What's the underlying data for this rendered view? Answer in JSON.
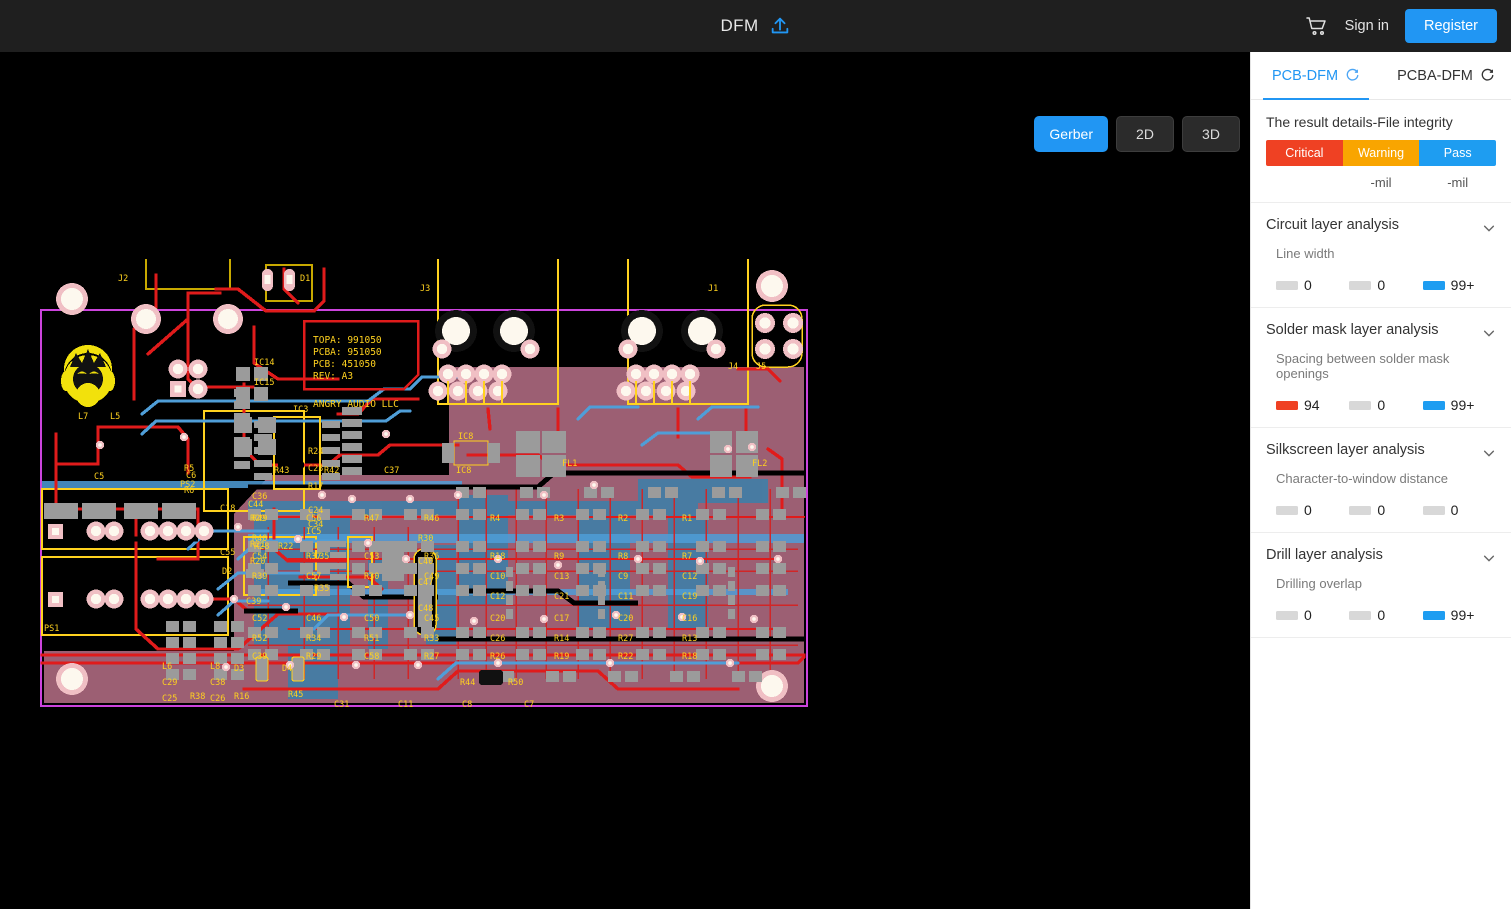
{
  "topbar": {
    "title": "DFM",
    "upload_icon": "upload-icon",
    "cart_icon": "cart-icon",
    "signin_label": "Sign in",
    "register_label": "Register"
  },
  "viewer": {
    "view_modes": [
      {
        "label": "Gerber",
        "active": true
      },
      {
        "label": "2D",
        "active": false
      },
      {
        "label": "3D",
        "active": false
      }
    ],
    "background": "#000000",
    "board": {
      "outline_color": "#cc44dd",
      "copper_pour_color": "#9c5f73",
      "silkscreen_color": "#ffd21f",
      "trace_red": "#e01b1b",
      "trace_blue": "#4f9ed8",
      "pad_color": "#f3c9cc",
      "drill_color": "#fdf6e3",
      "smd_pad_color": "#9b9b9b",
      "text_block": [
        "TOPA: 991050",
        "PCBA: 951050",
        "PCB: 451050",
        "REV: A3"
      ],
      "vendor": "ANGRY AUDIO LLC",
      "connector_labels": [
        "J1",
        "J2",
        "J3",
        "J4",
        "J5",
        "D1",
        "PS1",
        "PS2"
      ],
      "ic_labels": [
        "IC3",
        "IC5",
        "IC8",
        "IC14",
        "IC15"
      ],
      "filter_labels": [
        "FL1",
        "FL2"
      ],
      "diode_labels": [
        "D2",
        "D3",
        "D4"
      ],
      "inductor_labels": [
        "L5",
        "L6",
        "L7",
        "L8"
      ],
      "cap_labels": [
        "C5",
        "C6",
        "C7",
        "C8",
        "C9",
        "C10",
        "C11",
        "C12",
        "C13",
        "C16",
        "C17",
        "C18",
        "C19",
        "C20",
        "C21",
        "C23",
        "C24",
        "C25",
        "C26",
        "C31",
        "C32",
        "C34",
        "C35",
        "C36",
        "C37",
        "C38",
        "C39",
        "C40",
        "C43",
        "C44",
        "C45",
        "C46",
        "C47",
        "C48",
        "C49",
        "C50",
        "C52",
        "C53",
        "C54",
        "C55",
        "C56",
        "C57",
        "C58"
      ],
      "res_labels": [
        "R1",
        "R2",
        "R3",
        "R4",
        "R5",
        "R6",
        "R7",
        "R8",
        "R9",
        "R13",
        "R14",
        "R16",
        "R17",
        "R18",
        "R19",
        "R20",
        "R21",
        "R22",
        "R23",
        "R24",
        "R26",
        "R27",
        "R28",
        "R29",
        "R30",
        "R31",
        "R32",
        "R33",
        "R36",
        "R37",
        "R38",
        "R42",
        "R43",
        "R44",
        "R45",
        "R46",
        "R47",
        "R49",
        "R50",
        "R51",
        "R52"
      ]
    }
  },
  "panel": {
    "tabs": [
      {
        "label": "PCB-DFM",
        "active": true,
        "icon": "refresh-icon"
      },
      {
        "label": "PCBA-DFM",
        "active": false,
        "icon": "refresh-icon"
      }
    ],
    "heading": "The result details-File integrity",
    "legend": [
      {
        "label": "Critical",
        "color": "#ef4123"
      },
      {
        "label": "Warning",
        "color": "#f9a500"
      },
      {
        "label": "Pass",
        "color": "#1e9df1"
      }
    ],
    "mil_row": [
      "",
      "-mil",
      "-mil"
    ],
    "colors": {
      "critical": "#ef4123",
      "warning": "#f9a500",
      "pass": "#1e9df1",
      "neutral": "#d8d8d8",
      "accent": "#2196f3"
    },
    "sections": [
      {
        "title": "Circuit layer analysis",
        "subtitle": "Line width",
        "chevron": "chevron-down-icon",
        "counts": [
          {
            "value": "0",
            "color": "#d8d8d8",
            "level": "critical"
          },
          {
            "value": "0",
            "color": "#d8d8d8",
            "level": "warning"
          },
          {
            "value": "99+",
            "color": "#1e9df1",
            "level": "pass"
          }
        ]
      },
      {
        "title": "Solder mask layer analysis",
        "subtitle": "Spacing between solder mask openings",
        "chevron": "chevron-down-icon",
        "counts": [
          {
            "value": "94",
            "color": "#ef4123",
            "level": "critical"
          },
          {
            "value": "0",
            "color": "#d8d8d8",
            "level": "warning"
          },
          {
            "value": "99+",
            "color": "#1e9df1",
            "level": "pass"
          }
        ]
      },
      {
        "title": "Silkscreen layer analysis",
        "subtitle": "Character-to-window distance",
        "chevron": "chevron-down-icon",
        "counts": [
          {
            "value": "0",
            "color": "#d8d8d8",
            "level": "critical"
          },
          {
            "value": "0",
            "color": "#d8d8d8",
            "level": "warning"
          },
          {
            "value": "0",
            "color": "#d8d8d8",
            "level": "pass"
          }
        ]
      },
      {
        "title": "Drill layer analysis",
        "subtitle": "Drilling overlap",
        "chevron": "chevron-down-icon",
        "counts": [
          {
            "value": "0",
            "color": "#d8d8d8",
            "level": "critical"
          },
          {
            "value": "0",
            "color": "#d8d8d8",
            "level": "warning"
          },
          {
            "value": "99+",
            "color": "#1e9df1",
            "level": "pass"
          }
        ]
      }
    ]
  }
}
